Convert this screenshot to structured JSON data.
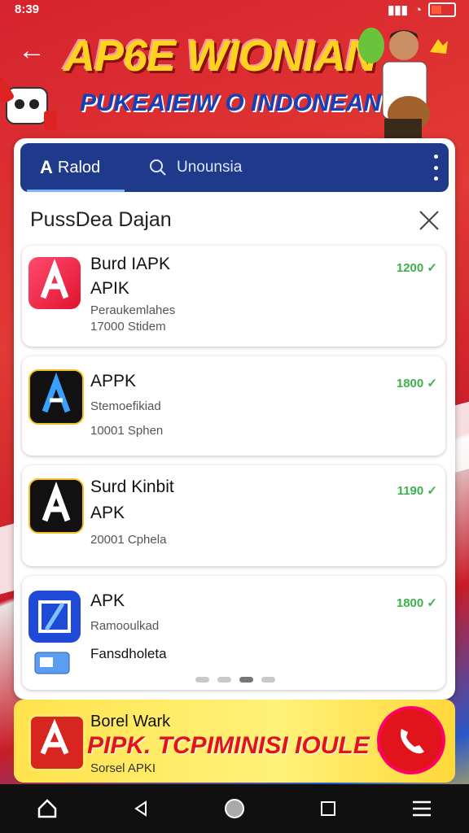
{
  "status": {
    "time": "8:39"
  },
  "hero": {
    "title": "AP6E WIONIAN",
    "subtitle": "PUKEAIEIW O INDONEAN"
  },
  "topbar": {
    "tab_label": "Ralod",
    "search_placeholder": "Unounsia"
  },
  "section": {
    "title": "PussDea Dajan"
  },
  "apps": [
    {
      "name_line1": "Burd IAPK",
      "name_line2": "APIK",
      "desc1": "Peraukemlahes",
      "desc2": "17000 Stidem",
      "count": "1200",
      "icon": "app-logo-pink"
    },
    {
      "name_line1": "APPK",
      "name_line2": "",
      "desc1": "Stemoefikiad",
      "desc2": "10001 Sphen",
      "count": "1800",
      "icon": "app-logo-black"
    },
    {
      "name_line1": "Surd Kinbit",
      "name_line2": "APK",
      "desc1": "",
      "desc2": "20001 Cphela",
      "count": "1190",
      "icon": "app-logo-dark"
    },
    {
      "name_line1": "APK",
      "name_line2": "",
      "desc1": "Ramooulkad",
      "desc2": "Fansdholeta",
      "count": "1800",
      "icon": "app-logo-blue"
    }
  ],
  "promo": {
    "title": "Borel Wark",
    "text": "PIPK. TCPIMINISI IOULE 600%",
    "sub": "Sorsel APKI"
  },
  "colors": {
    "accent_blue": "#1f3a8a",
    "count_green": "#3bb34a",
    "promo_red": "#e0141a"
  }
}
